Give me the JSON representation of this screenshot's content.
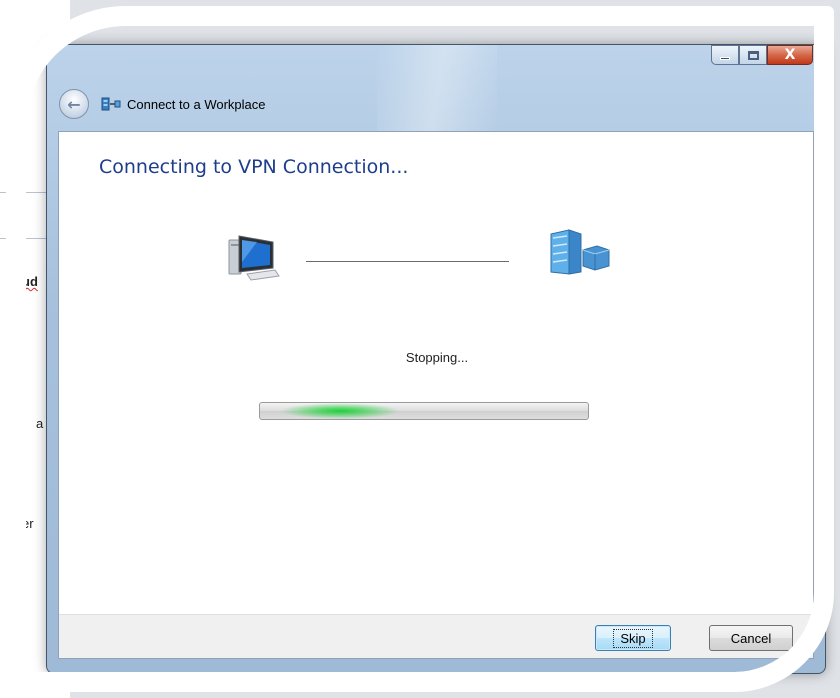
{
  "background": {
    "fragments": [
      {
        "text": "ud"
      },
      {
        "text": "a"
      },
      {
        "text": "er"
      }
    ]
  },
  "window": {
    "title": "Connect to a Workplace",
    "caption_buttons": {
      "minimize_icon": "minimize-icon",
      "maximize_icon": "maximize-icon",
      "close_label": "X"
    },
    "back_icon": "back-arrow-icon"
  },
  "content": {
    "heading": "Connecting to VPN Connection...",
    "status": "Stopping...",
    "progress_state": "indeterminate",
    "progress_color": "#1fd03a"
  },
  "footer": {
    "skip_label": "Skip",
    "cancel_label": "Cancel"
  },
  "colors": {
    "heading": "#1e3d8c",
    "close_button": "#c0391b"
  }
}
